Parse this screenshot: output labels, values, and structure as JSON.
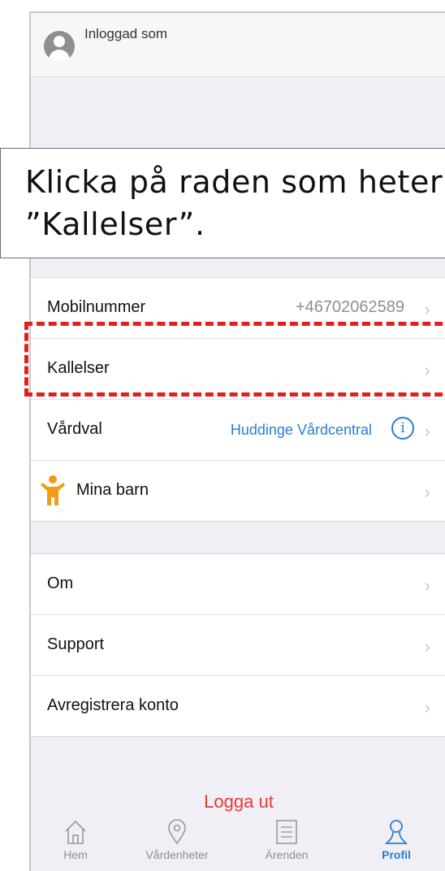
{
  "header": {
    "logged_in_label": "Inloggad som"
  },
  "callout": {
    "line1": "Klicka på raden som heter",
    "line2": "”Kallelser”."
  },
  "settings_group": [
    {
      "label": "Mobilnummer",
      "value": "+46702062589"
    },
    {
      "label": "Kallelser"
    },
    {
      "label": "Vårdval",
      "value": "Huddinge Vårdcentral",
      "info_glyph": "i"
    },
    {
      "label": "Mina barn",
      "icon": "child-icon"
    }
  ],
  "about_group": [
    {
      "label": "Om"
    },
    {
      "label": "Support"
    },
    {
      "label": "Avregistrera konto"
    }
  ],
  "logout_label": "Logga ut",
  "tabs": [
    {
      "label": "Hem",
      "icon": "home-icon"
    },
    {
      "label": "Vårdenheter",
      "icon": "location-pin-icon"
    },
    {
      "label": "Ärenden",
      "icon": "list-icon"
    },
    {
      "label": "Profil",
      "icon": "person-icon",
      "active": true
    }
  ],
  "colors": {
    "accent": "#2a7fd1",
    "logout": "#e53935",
    "highlight": "#e41e1e",
    "child_icon": "#f39c12"
  }
}
